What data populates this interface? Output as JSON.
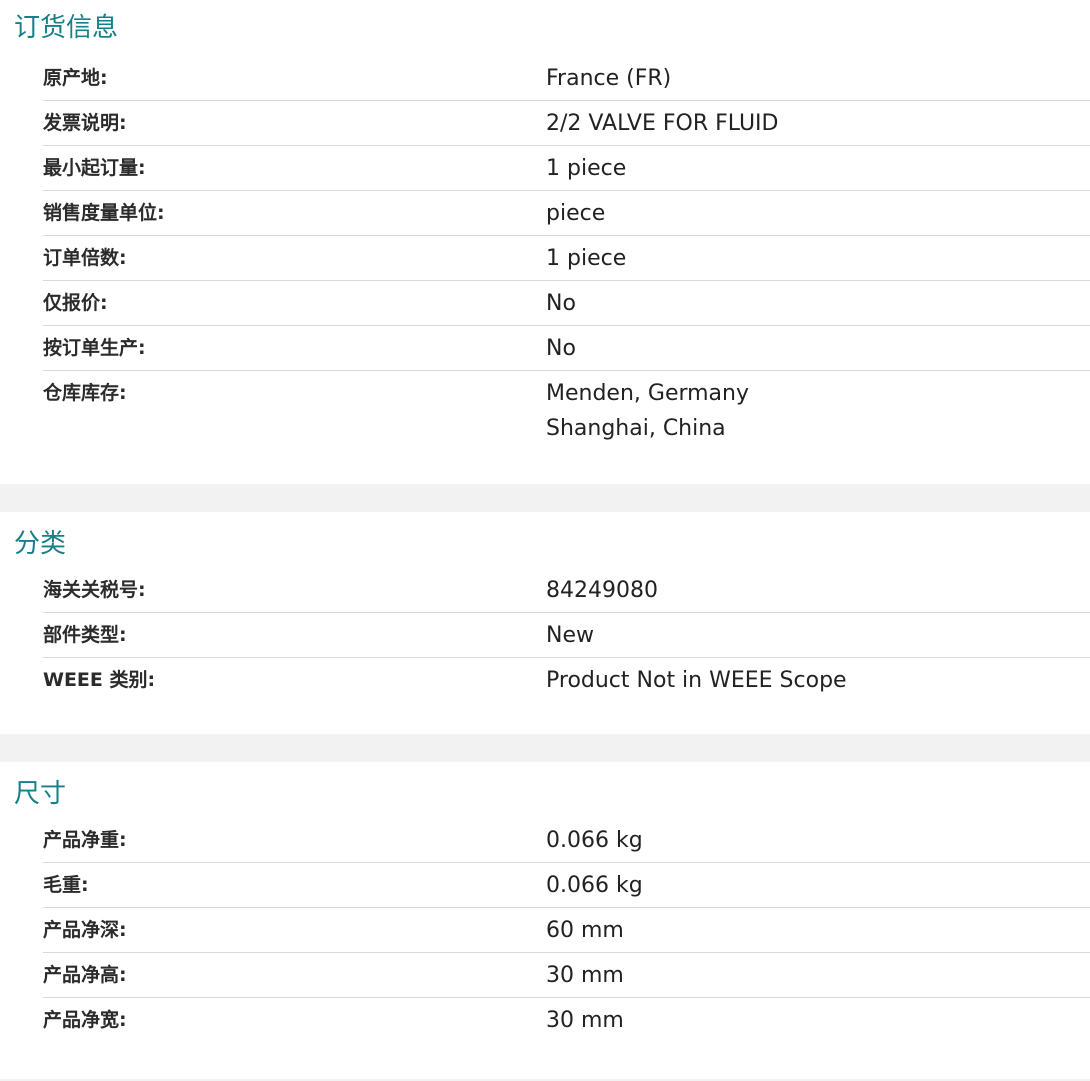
{
  "ordering": {
    "title": "订货信息",
    "rows": [
      {
        "label": "原产地:",
        "value": "France (FR)"
      },
      {
        "label": "发票说明:",
        "value": "2/2 VALVE FOR FLUID"
      },
      {
        "label": "最小起订量:",
        "value": "1 piece"
      },
      {
        "label": "销售度量单位:",
        "value": "piece"
      },
      {
        "label": "订单倍数:",
        "value": "1 piece"
      },
      {
        "label": "仅报价:",
        "value": "No"
      },
      {
        "label": "按订单生产:",
        "value": "No"
      },
      {
        "label": "仓库库存:",
        "values": [
          "Menden, Germany",
          "Shanghai, China"
        ]
      }
    ]
  },
  "classification": {
    "title": "分类",
    "rows": [
      {
        "label": "海关关税号:",
        "value": "84249080"
      },
      {
        "label": "部件类型:",
        "value": "New"
      },
      {
        "label": "WEEE 类别:",
        "value": "Product Not in WEEE Scope"
      }
    ]
  },
  "dimensions": {
    "title": "尺寸",
    "rows": [
      {
        "label": "产品净重:",
        "value": "0.066 kg"
      },
      {
        "label": "毛重:",
        "value": "0.066 kg"
      },
      {
        "label": "产品净深:",
        "value": "60 mm"
      },
      {
        "label": "产品净高:",
        "value": "30 mm"
      },
      {
        "label": "产品净宽:",
        "value": "30 mm"
      }
    ]
  }
}
